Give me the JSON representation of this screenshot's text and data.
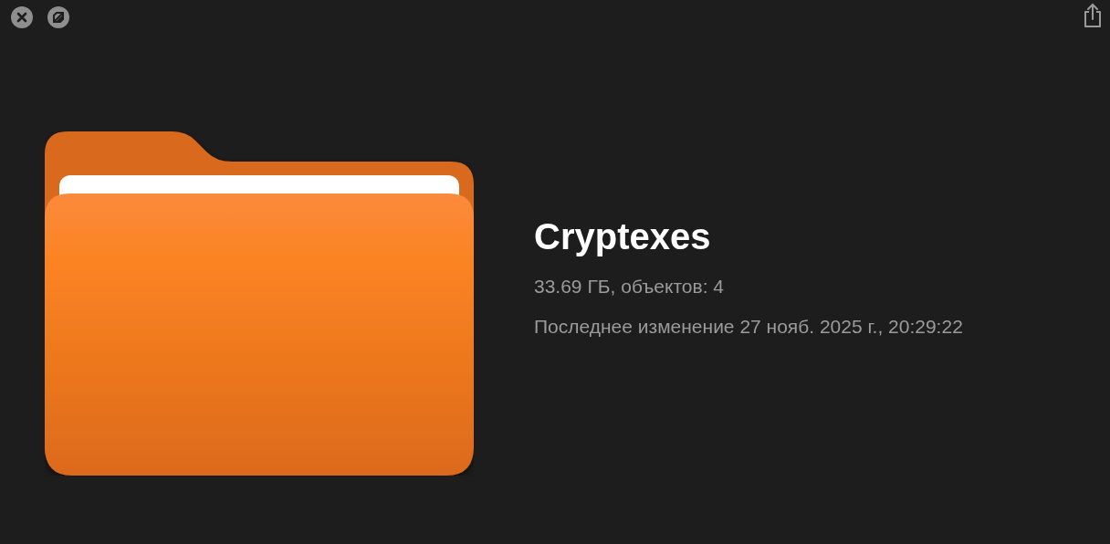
{
  "title": "Cryptexes",
  "details": [
    "33.69 ГБ, объектов: 4",
    "Последнее изменение 27 нояб. 2025 г., 20:29:22"
  ]
}
